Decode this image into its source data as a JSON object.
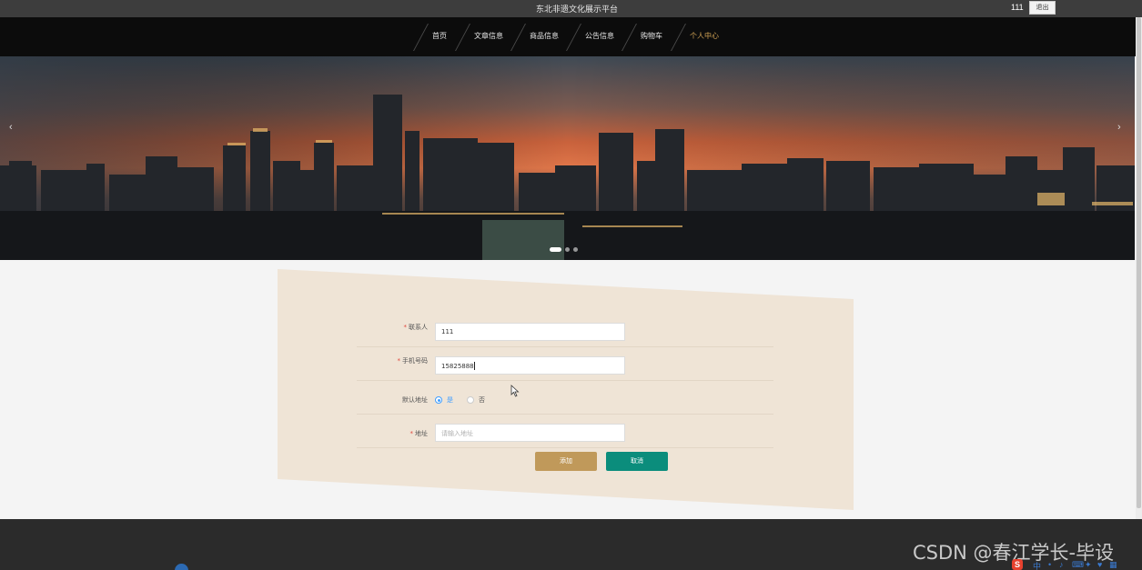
{
  "header": {
    "site_title": "东北非遗文化展示平台",
    "username": "111",
    "logout_label": "退出"
  },
  "nav": {
    "items": [
      {
        "label": "首页",
        "active": false
      },
      {
        "label": "文章信息",
        "active": false
      },
      {
        "label": "商品信息",
        "active": false
      },
      {
        "label": "公告信息",
        "active": false
      },
      {
        "label": "购物车",
        "active": false
      },
      {
        "label": "个人中心",
        "active": true
      }
    ]
  },
  "banner": {
    "prev_icon": "‹",
    "next_icon": "›",
    "slide_count": 3,
    "active_slide": 1
  },
  "form": {
    "contact": {
      "label": "联系人",
      "required": true,
      "value": "111"
    },
    "phone": {
      "label": "手机号码",
      "required": true,
      "value": "15825888"
    },
    "default_address": {
      "label": "默认地址",
      "options": [
        "是",
        "否"
      ],
      "selected": "是"
    },
    "address": {
      "label": "地址",
      "required": true,
      "value": "",
      "placeholder": "请输入地址"
    },
    "add_button": "添加",
    "cancel_button": "取消"
  },
  "watermark": "CSDN @春江学长-毕设",
  "tray": {
    "ime_logo": "S",
    "items": [
      "中",
      "•",
      "♪",
      "⌨",
      "✦",
      "♥",
      "▦"
    ]
  },
  "colors": {
    "accent_gold": "#c0995a",
    "accent_teal": "#0b8d7c",
    "nav_active": "#d2a355",
    "form_bg": "#efe4d6"
  }
}
